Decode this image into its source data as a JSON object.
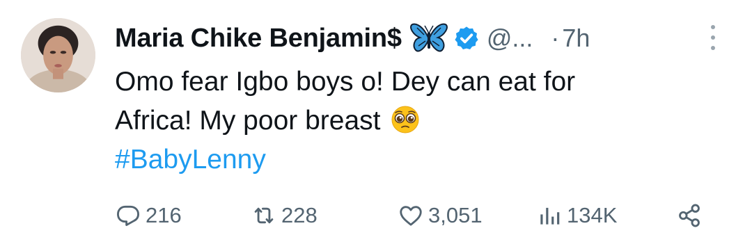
{
  "tweet": {
    "author": {
      "name": "Maria Chike Benjamin$",
      "handle": "@...",
      "verified": true,
      "verified_color": "#1d9bf0",
      "badges": [
        "butterfly-emoji",
        "verified-badge-icon"
      ]
    },
    "time_separator": "·",
    "time": "7h",
    "text_lines": [
      "Omo fear Igbo boys o! Dey can eat for",
      "Africa! My poor breast"
    ],
    "text_emoji": "pleading-face-emoji",
    "hashtag": "#BabyLenny",
    "hashtag_color": "#1d9bf0",
    "actions": {
      "replies": "216",
      "reposts": "228",
      "likes": "3,051",
      "views": "134K"
    },
    "icons": {
      "reply": "reply-icon",
      "repost": "repost-icon",
      "like": "heart-icon",
      "views": "views-icon",
      "share": "share-icon",
      "more": "more-vertical-icon"
    },
    "muted_color": "#536471"
  }
}
